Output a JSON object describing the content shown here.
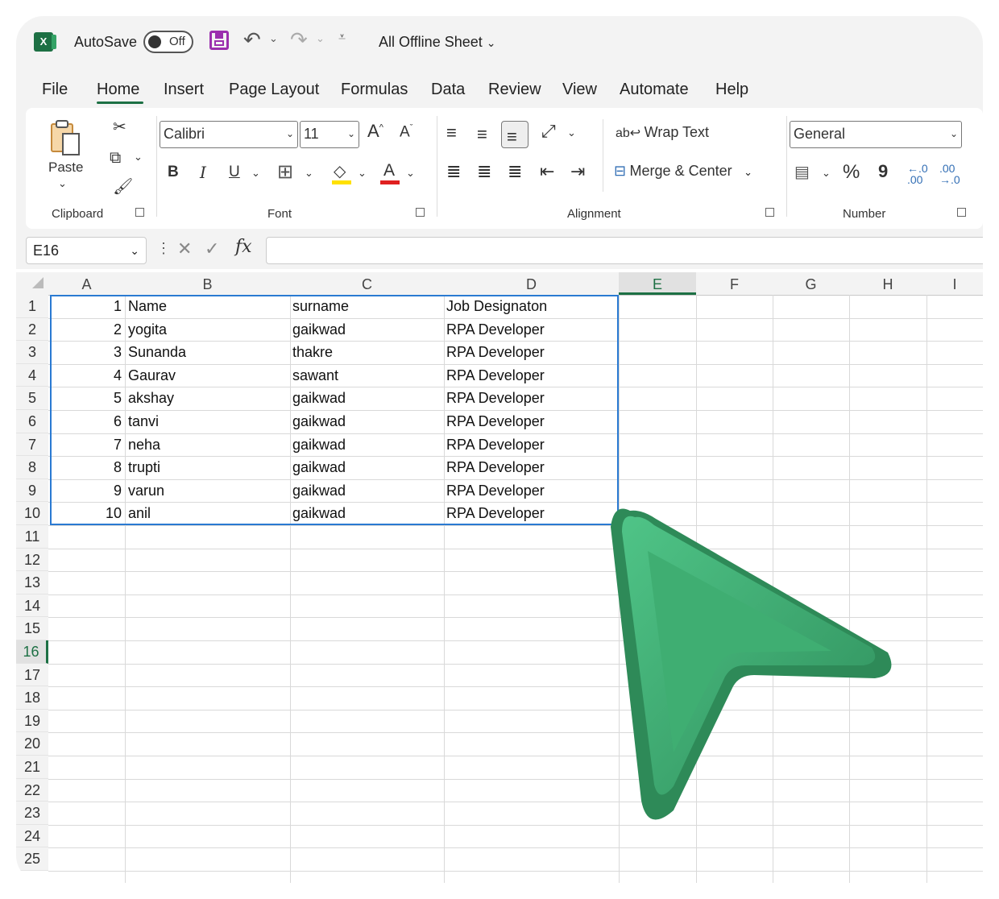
{
  "title_bar": {
    "autosave_label": "AutoSave",
    "autosave_state": "Off",
    "file_title": "All Offline Sheet"
  },
  "menu_tabs": [
    "File",
    "Home",
    "Insert",
    "Page Layout",
    "Formulas",
    "Data",
    "Review",
    "View",
    "Automate",
    "Help"
  ],
  "active_tab": "Home",
  "ribbon": {
    "clipboard": {
      "paste_label": "Paste",
      "group_label": "Clipboard"
    },
    "font": {
      "font_name": "Calibri",
      "font_size": "11",
      "bold": "B",
      "italic": "I",
      "underline": "U",
      "group_label": "Font"
    },
    "alignment": {
      "wrap_text": "Wrap Text",
      "merge_center": "Merge & Center",
      "group_label": "Alignment"
    },
    "number": {
      "format": "General",
      "percent": "%",
      "comma": "9",
      "group_label": "Number"
    }
  },
  "formula_bar": {
    "name_box": "E16",
    "fx": "fx",
    "formula": ""
  },
  "columns": [
    "A",
    "B",
    "C",
    "D",
    "E",
    "F",
    "G",
    "H",
    "I"
  ],
  "selected_column": "E",
  "rows": [
    "1",
    "2",
    "3",
    "4",
    "5",
    "6",
    "7",
    "8",
    "9",
    "10",
    "11",
    "12",
    "13",
    "14",
    "15",
    "16",
    "17",
    "18",
    "19",
    "20",
    "21",
    "22",
    "23",
    "24",
    "25"
  ],
  "selected_row": "16",
  "sheet_data": [
    [
      "1",
      "Name",
      "surname",
      "Job Designaton"
    ],
    [
      "2",
      "yogita",
      "gaikwad",
      "RPA Developer"
    ],
    [
      "3",
      "Sunanda",
      "thakre",
      "RPA Developer"
    ],
    [
      "4",
      "Gaurav",
      "sawant",
      "RPA Developer"
    ],
    [
      "5",
      "akshay",
      "gaikwad",
      "RPA Developer"
    ],
    [
      "6",
      "tanvi",
      "gaikwad",
      "RPA Developer"
    ],
    [
      "7",
      "neha",
      "gaikwad",
      "RPA Developer"
    ],
    [
      "8",
      "trupti",
      "gaikwad",
      "RPA Developer"
    ],
    [
      "9",
      "varun",
      "gaikwad",
      "RPA Developer"
    ],
    [
      "10",
      "anil",
      "gaikwad",
      "RPA Developer"
    ]
  ],
  "colors": {
    "excel_green": "#1d7044",
    "selection_blue": "#2a7ad2",
    "cursor_green": "#3aa86d",
    "save_purple": "#9b2fae"
  }
}
